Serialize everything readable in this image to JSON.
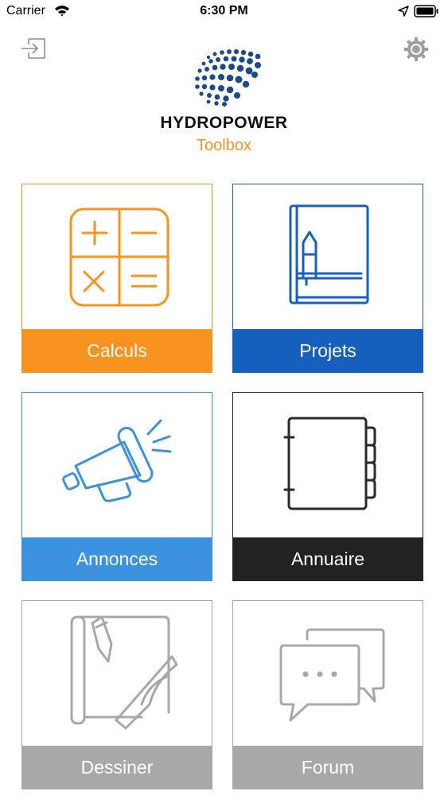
{
  "status_bar": {
    "carrier": "Carrier",
    "time": "6:30 PM"
  },
  "header": {
    "brand_name": "HYDROPOWER",
    "brand_sub": "Toolbox",
    "logout_icon": "logout-icon",
    "settings_icon": "gear-icon"
  },
  "tiles": [
    {
      "label": "Calculs",
      "icon": "calculator-icon",
      "color": "#f7931e"
    },
    {
      "label": "Projets",
      "icon": "notebook-pen-icon",
      "color": "#1560bd"
    },
    {
      "label": "Annonces",
      "icon": "megaphone-icon",
      "color": "#3b93e0"
    },
    {
      "label": "Annuaire",
      "icon": "address-book-icon",
      "color": "#222222"
    },
    {
      "label": "Dessiner",
      "icon": "drawing-tools-icon",
      "color": "#a8a8a8"
    },
    {
      "label": "Forum",
      "icon": "chat-bubbles-icon",
      "color": "#a8a8a8"
    }
  ]
}
